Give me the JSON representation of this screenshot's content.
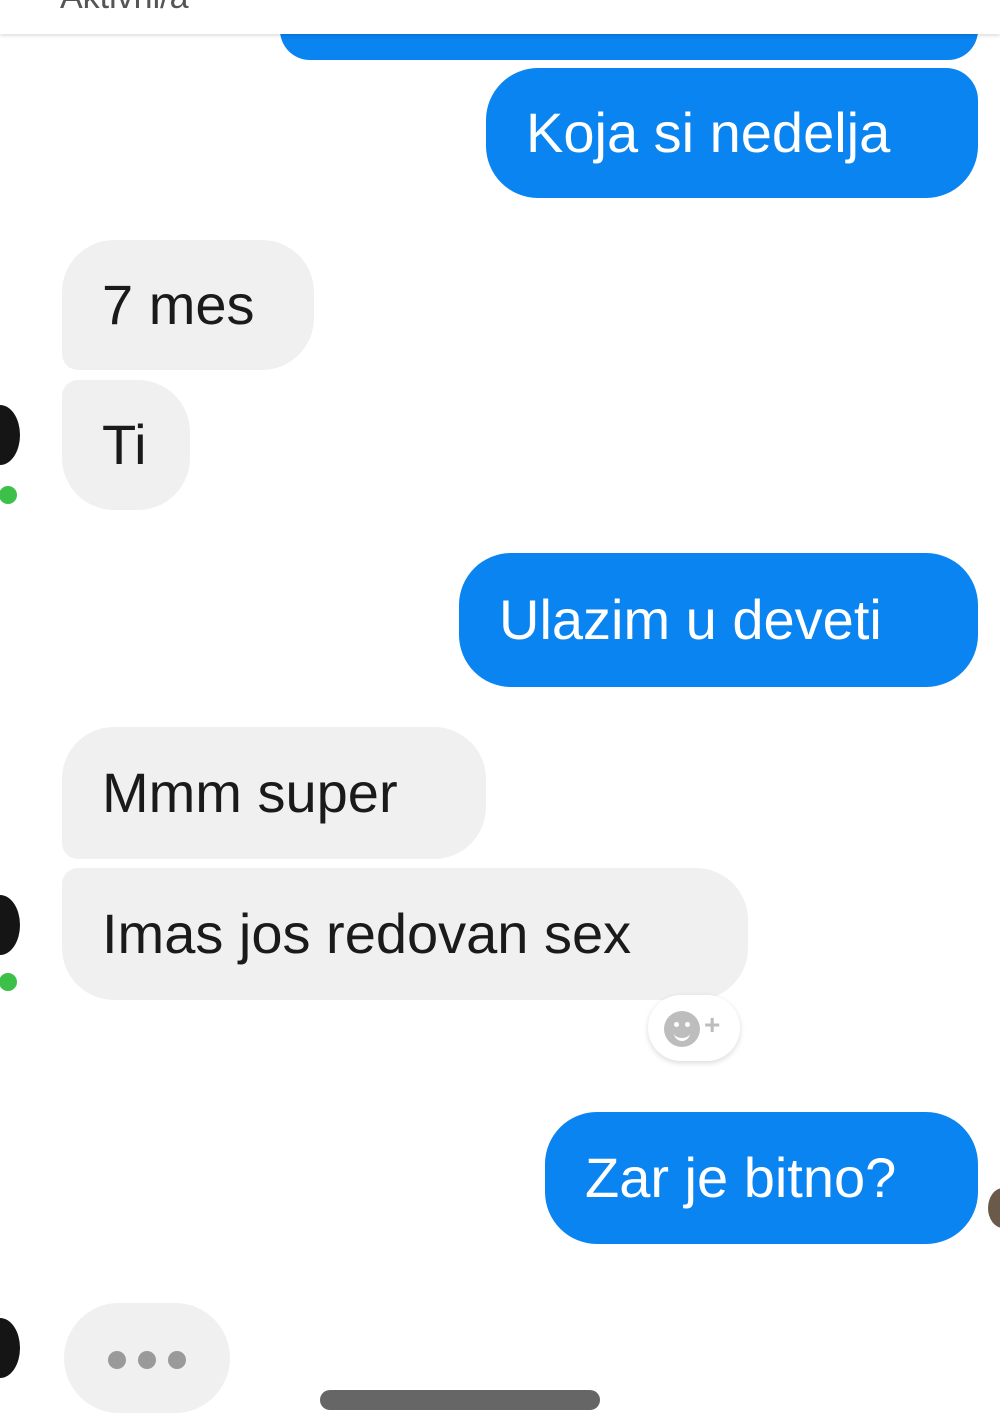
{
  "header": {
    "status_text": "Aktivni/a"
  },
  "messages": [
    {
      "side": "out",
      "text": "Koja si nedelja"
    },
    {
      "side": "in",
      "text": "7 mes"
    },
    {
      "side": "in",
      "text": "Ti"
    },
    {
      "side": "out",
      "text": "Ulazim u deveti"
    },
    {
      "side": "in",
      "text": "Mmm super"
    },
    {
      "side": "in",
      "text": "Imas jos redovan sex"
    },
    {
      "side": "out",
      "text": "Zar je bitno?"
    }
  ],
  "colors": {
    "outgoing_bubble": "#0a84f0",
    "incoming_bubble": "#f0f0f0",
    "online_indicator": "#3cc04a"
  },
  "icons": {
    "reaction": "add-reaction-icon",
    "typing": "typing-indicator-icon"
  }
}
